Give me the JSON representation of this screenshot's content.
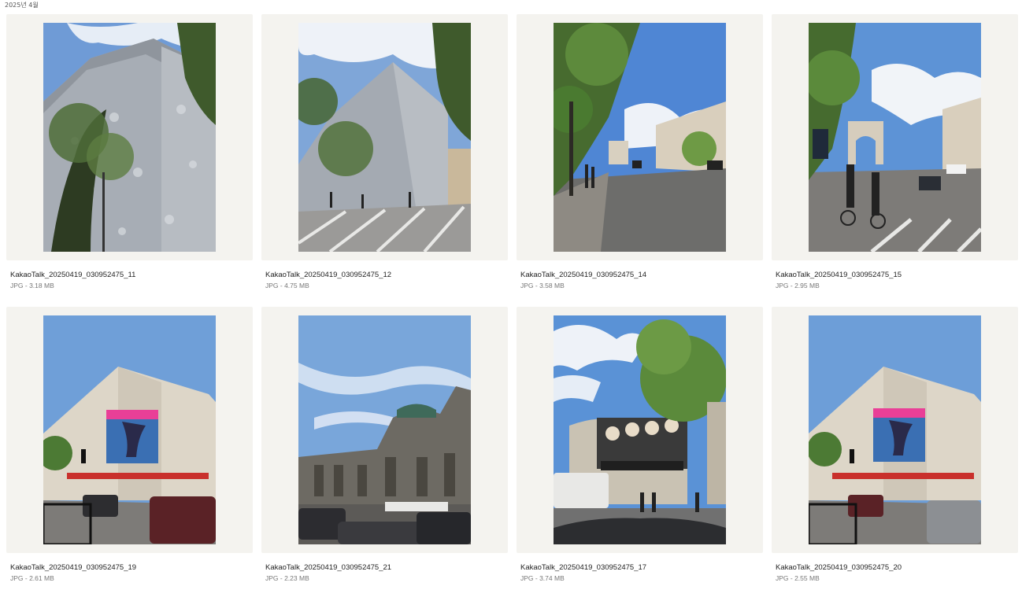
{
  "section": {
    "title": "2025년 4월"
  },
  "files": [
    {
      "name": "KakaoTalk_20250419_030952475_11",
      "meta": "JPG - 3.18 MB",
      "scene": "lv-building-close"
    },
    {
      "name": "KakaoTalk_20250419_030952475_12",
      "meta": "JPG - 4.75 MB",
      "scene": "lv-building-wide"
    },
    {
      "name": "KakaoTalk_20250419_030952475_14",
      "meta": "JPG - 3.58 MB",
      "scene": "avenue-arc"
    },
    {
      "name": "KakaoTalk_20250419_030952475_15",
      "meta": "JPG - 2.95 MB",
      "scene": "arc-cyclists"
    },
    {
      "name": "KakaoTalk_20250419_030952475_19",
      "meta": "JPG - 2.61 MB",
      "scene": "galeries-billboard"
    },
    {
      "name": "KakaoTalk_20250419_030952475_21",
      "meta": "JPG - 2.23 MB",
      "scene": "opera-sky"
    },
    {
      "name": "KakaoTalk_20250419_030952475_17",
      "meta": "JPG - 3.74 MB",
      "scene": "ralph-lauren-billboard"
    },
    {
      "name": "KakaoTalk_20250419_030952475_20",
      "meta": "JPG - 2.55 MB",
      "scene": "galeries-billboard"
    }
  ]
}
